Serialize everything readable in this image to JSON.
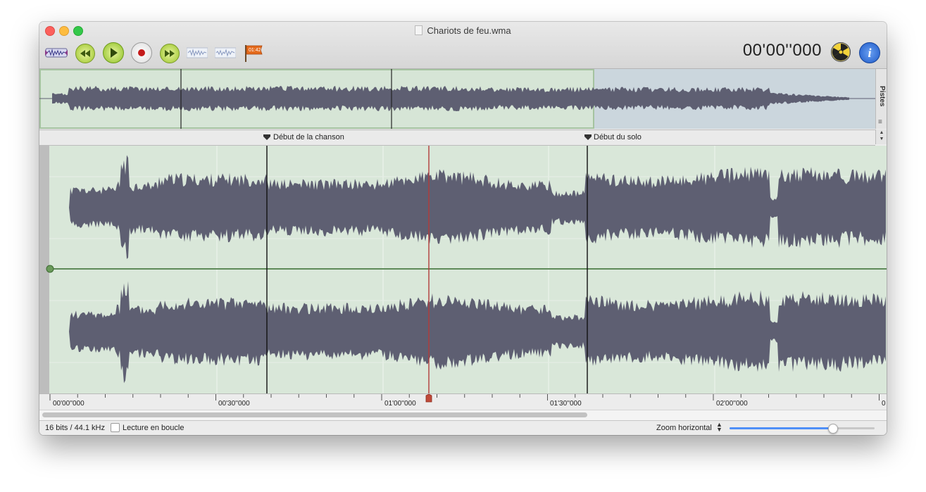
{
  "window": {
    "title": "Chariots de feu.wma"
  },
  "toolbar": {
    "icons": [
      "waveform-tool-icon",
      "rewind-icon",
      "play-icon",
      "record-icon",
      "fast-forward-icon",
      "waveform-a-icon",
      "waveform-b-icon",
      "flag-icon",
      "nuclear-icon",
      "info-icon"
    ],
    "flag_badge": "01:42",
    "timecode": "00'00''000"
  },
  "overview": {
    "side_tab": "Pistes"
  },
  "markers": [
    {
      "label": "Début de la chanson"
    },
    {
      "label": "Début du solo"
    }
  ],
  "ruler": {
    "ticks": [
      "00'00''000",
      "00'30''000",
      "01'00''000",
      "01'30''000",
      "02'00''000",
      "0"
    ]
  },
  "playhead": {
    "position_seconds": 68
  },
  "status": {
    "format": "16 bits / 44.1 kHz",
    "loop_label": "Lecture en boucle",
    "loop_checked": false,
    "zoom_label": "Zoom horizontal",
    "zoom_level": 0.71
  },
  "colors": {
    "selection": "#d6e5d6",
    "waveform": "#5e5f72",
    "playhead": "#b33a3a",
    "overview_unselected": "#cbd6dd"
  }
}
